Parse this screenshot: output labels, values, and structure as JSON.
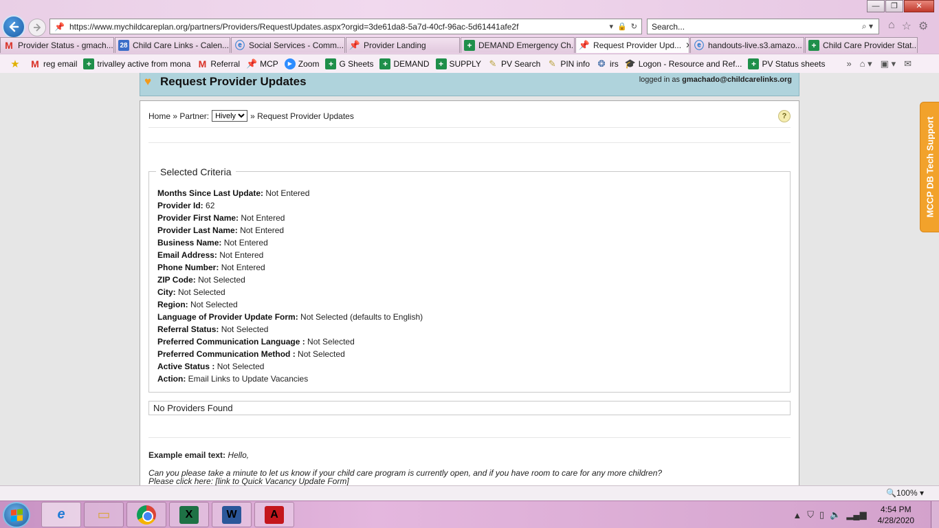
{
  "browser": {
    "window_controls": {
      "minimize": "—",
      "maximize": "❐",
      "close": "✕"
    },
    "address_url": "https://www.mychildcareplan.org/partners/Providers/RequestUpdates.aspx?orgid=3de61da8-5a7d-40cf-96ac-5d61441afe2f",
    "search_placeholder": "Search...",
    "tabs": [
      {
        "label": "Provider Status - gmach...",
        "icon": "gmail-icon"
      },
      {
        "label": "Child Care Links - Calen...",
        "icon": "calendar-icon",
        "icon_text": "28"
      },
      {
        "label": "Social Services - Comm...",
        "icon": "ie-icon"
      },
      {
        "label": "Provider Landing",
        "icon": "pin-icon"
      },
      {
        "label": "DEMAND Emergency Ch...",
        "icon": "sheets-icon"
      },
      {
        "label": "Request Provider Upd...",
        "icon": "pin-icon",
        "active": true,
        "close": "✕"
      },
      {
        "label": "handouts-live.s3.amazo...",
        "icon": "ie-icon"
      },
      {
        "label": "Child Care Provider Stat...",
        "icon": "sheets-icon"
      }
    ],
    "favorites": [
      {
        "label": "reg email",
        "icon": "gmail-icon"
      },
      {
        "label": "trivalley active from mona",
        "icon": "sheets-icon"
      },
      {
        "label": "Referral",
        "icon": "gmail-icon"
      },
      {
        "label": "MCP",
        "icon": "pin-icon"
      },
      {
        "label": "Zoom",
        "icon": "zoom-icon"
      },
      {
        "label": "G Sheets",
        "icon": "sheets-icon"
      },
      {
        "label": "DEMAND",
        "icon": "sheets-icon"
      },
      {
        "label": "SUPPLY",
        "icon": "sheets-icon"
      },
      {
        "label": "PV Search",
        "icon": "pv-icon"
      },
      {
        "label": "PIN info",
        "icon": "pv-icon"
      },
      {
        "label": "irs",
        "icon": "irs-icon"
      },
      {
        "label": "Logon - Resource and Ref...",
        "icon": "cap-icon"
      },
      {
        "label": "PV Status sheets",
        "icon": "sheets-icon"
      }
    ]
  },
  "page": {
    "title": "Request Provider Updates",
    "logged_in_prefix": "logged in as",
    "logged_in_user": "gmachado@childcarelinks.org",
    "breadcrumb": {
      "home": "Home",
      "sep": "»",
      "partner_label": "Partner:",
      "partner_selected": "Hively",
      "current": "Request Provider Updates"
    },
    "help": "?",
    "criteria_title": "Selected Criteria",
    "criteria": [
      {
        "label": "Months Since Last Update:",
        "value": "Not Entered"
      },
      {
        "label": "Provider Id:",
        "value": "62"
      },
      {
        "label": "Provider First Name:",
        "value": "Not Entered"
      },
      {
        "label": "Provider Last Name:",
        "value": "Not Entered"
      },
      {
        "label": "Business Name:",
        "value": "Not Entered"
      },
      {
        "label": "Email Address:",
        "value": "Not Entered"
      },
      {
        "label": "Phone Number:",
        "value": "Not Entered"
      },
      {
        "label": "ZIP Code:",
        "value": "Not Selected"
      },
      {
        "label": "City:",
        "value": "Not Selected"
      },
      {
        "label": "Region:",
        "value": "Not Selected"
      },
      {
        "label": "Language of Provider Update Form:",
        "value": "Not Selected (defaults to English)"
      },
      {
        "label": "Referral Status:",
        "value": "Not Selected"
      },
      {
        "label": "Preferred Communication Language :",
        "value": "Not Selected"
      },
      {
        "label": "Preferred Communication Method :",
        "value": "Not Selected"
      },
      {
        "label": "Active Status :",
        "value": "Not Selected"
      },
      {
        "label": "Action:",
        "value": "Email Links to Update Vacancies"
      }
    ],
    "no_results": "No Providers Found",
    "email_label": "Example email text:",
    "email_greeting": "Hello,",
    "email_body_1": "Can you please take a minute to let us know if your child care program is currently open, and if you have room to care for any more children?",
    "email_body_2": "Please click here: [link to Quick Vacancy Update Form]",
    "tech_support": "MCCP DB Tech Support"
  },
  "statusbar": {
    "zoom": "🔍100% ▾"
  },
  "taskbar": {
    "apps": [
      "internet-explorer",
      "file-explorer",
      "chrome",
      "excel",
      "word",
      "acrobat"
    ],
    "time": "4:54 PM",
    "date": "4/28/2020"
  }
}
